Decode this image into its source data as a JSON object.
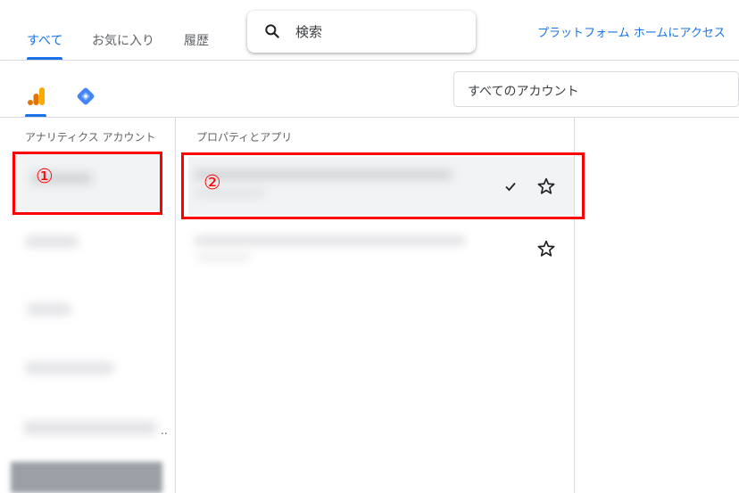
{
  "tabs": [
    {
      "label": "すべて",
      "active": true
    },
    {
      "label": "お気に入り",
      "active": false
    },
    {
      "label": "履歴",
      "active": false
    }
  ],
  "search": {
    "placeholder": "検索",
    "icon": "search-icon"
  },
  "header": {
    "home_link": "プラットフォーム ホームにアクセス"
  },
  "products": [
    {
      "name": "analytics-icon",
      "selected": true
    },
    {
      "name": "tag-manager-icon",
      "selected": false
    }
  ],
  "account_filter": {
    "label": "すべてのアカウント"
  },
  "columns": {
    "accounts_header": "アナリティクス アカウント",
    "properties_header": "プロパティとアプリ"
  },
  "annotations": {
    "one": "①",
    "two": "②"
  },
  "overflow_indicator": "..",
  "colors": {
    "accent": "#1a73e8",
    "annotation": "#ff0000",
    "selected_row": "#f1f3f4",
    "analytics_orange": "#f9ab00",
    "analytics_dark": "#e37400",
    "tag_manager_blue": "#4285f4"
  }
}
